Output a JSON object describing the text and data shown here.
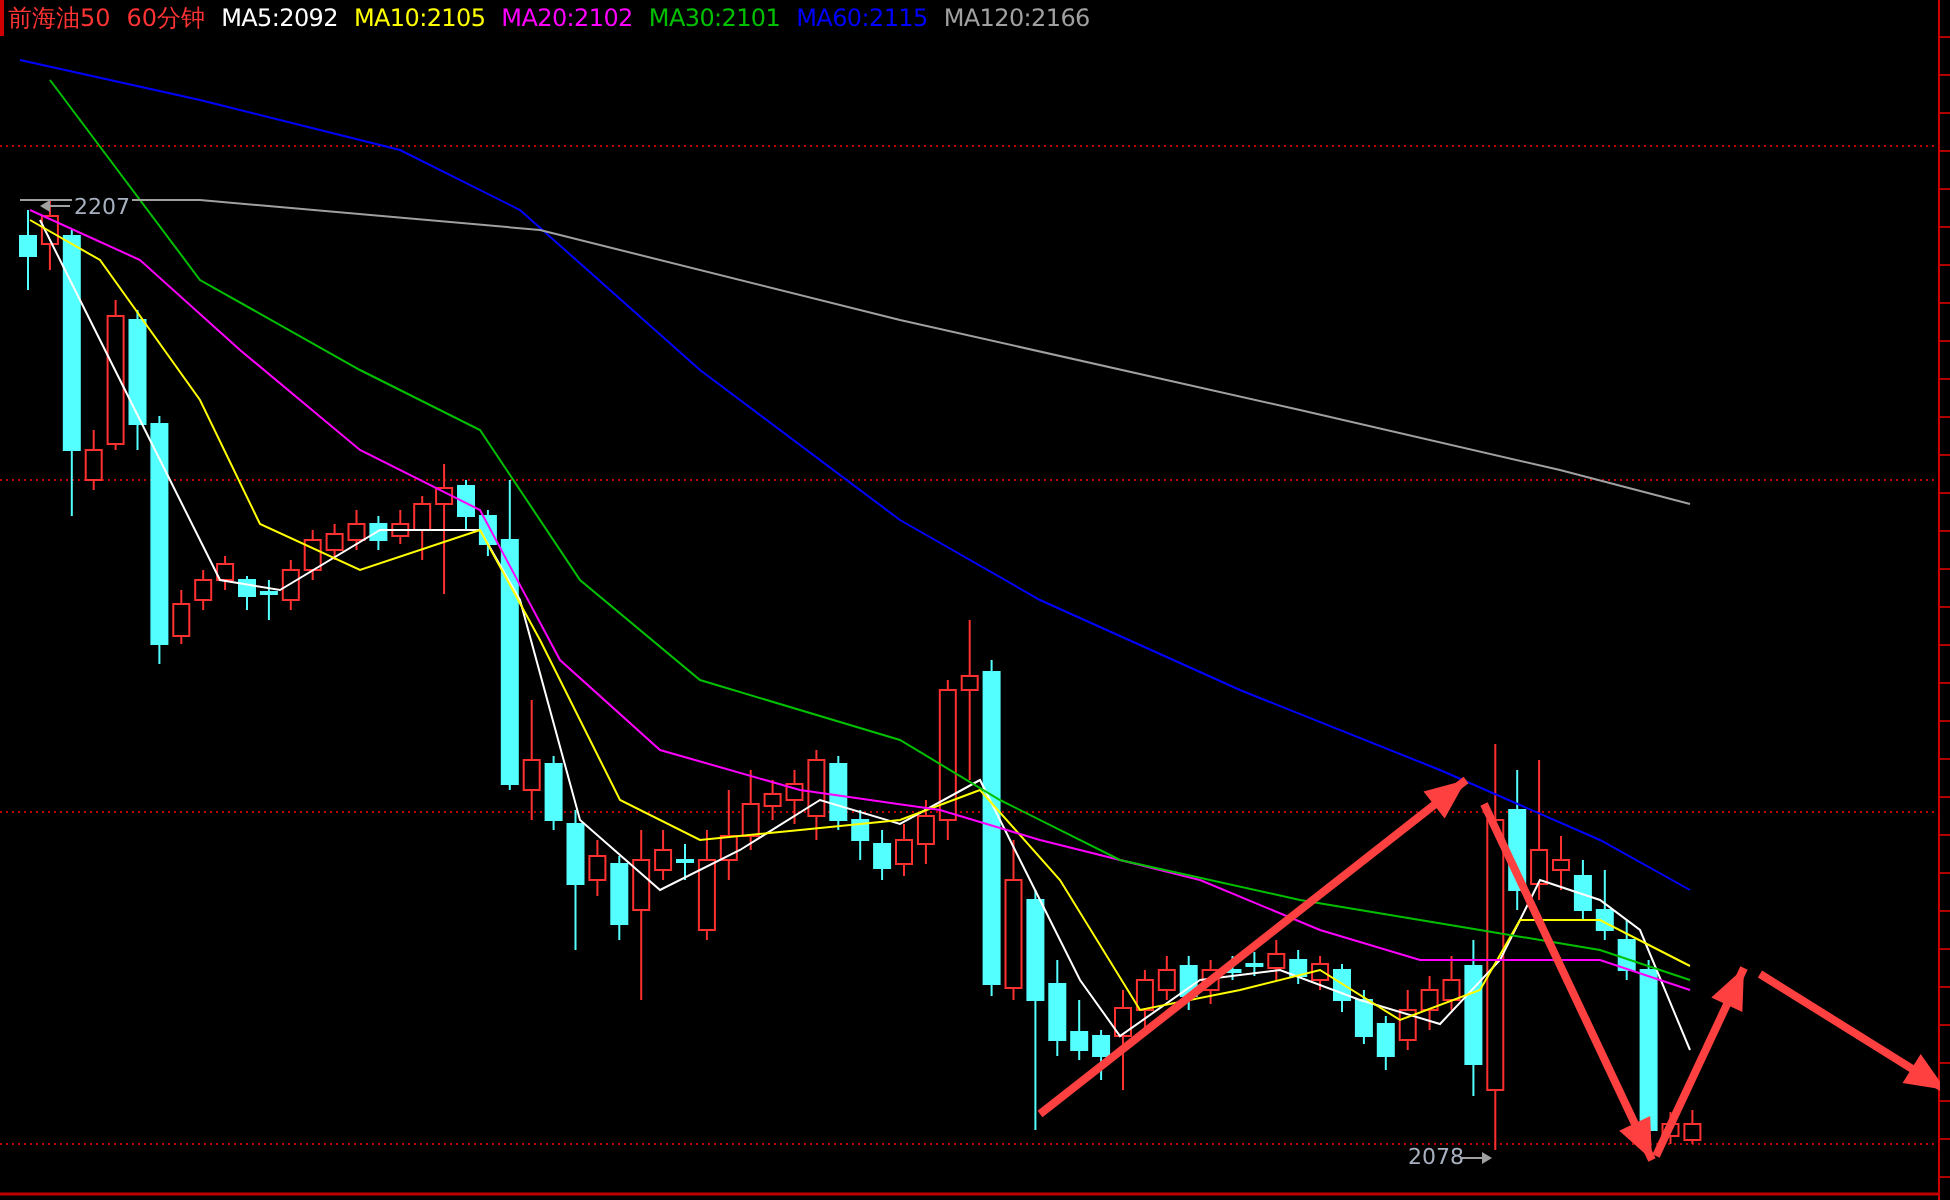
{
  "header": {
    "instrument": "前海油50",
    "period": "60分钟",
    "indicators": [
      {
        "label": "MA5:2092",
        "color": "#ffffff"
      },
      {
        "label": "MA10:2105",
        "color": "#ffff00"
      },
      {
        "label": "MA20:2102",
        "color": "#ff00ff"
      },
      {
        "label": "MA30:2101",
        "color": "#00c000"
      },
      {
        "label": "MA60:2115",
        "color": "#0000ff"
      },
      {
        "label": "MA120:2166",
        "color": "#a0a0a0"
      }
    ]
  },
  "chart_labels": {
    "high": "2207",
    "low": "2078"
  }
}
